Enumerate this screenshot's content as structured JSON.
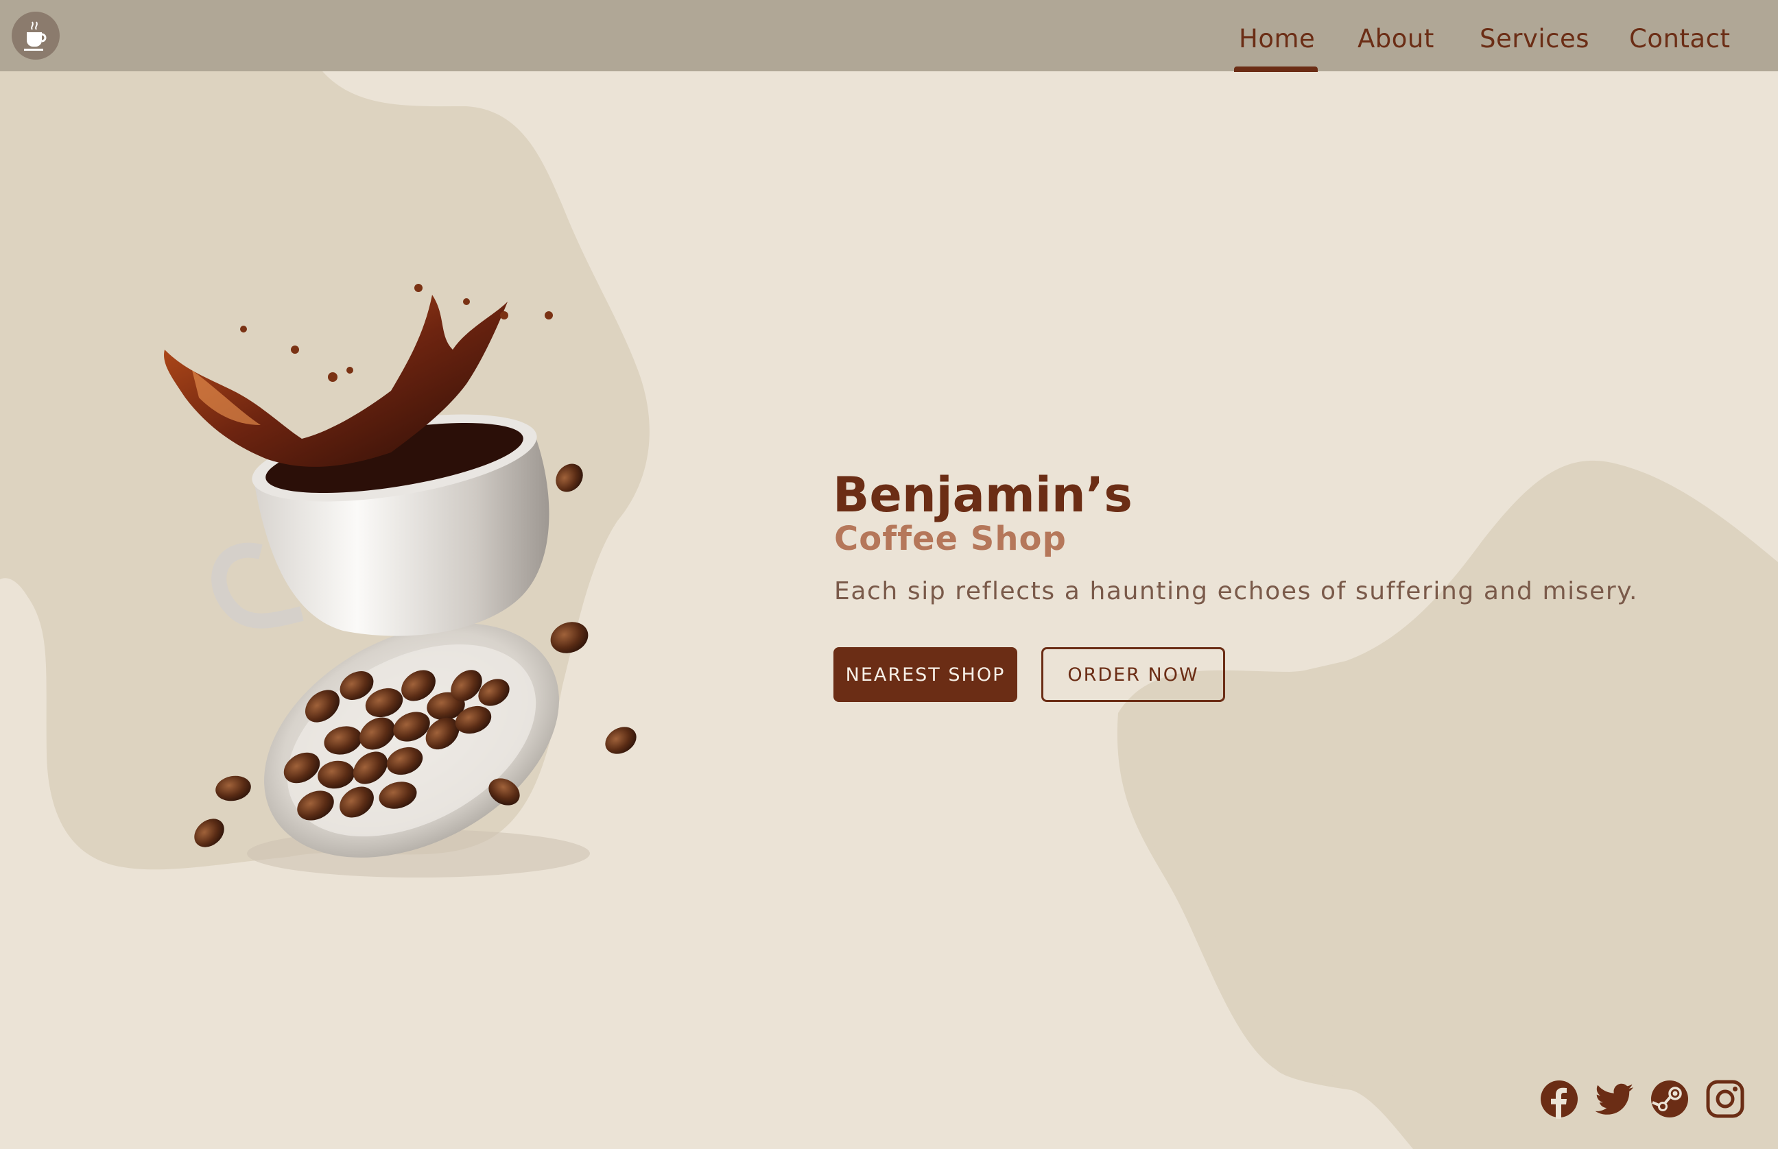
{
  "nav": {
    "items": [
      {
        "label": "Home"
      },
      {
        "label": "About"
      },
      {
        "label": "Services"
      },
      {
        "label": "Contact"
      }
    ],
    "active": "Home"
  },
  "hero": {
    "title": "Benjamin’s",
    "subtitle": "Coffee Shop",
    "tagline": "Each sip reflects a haunting echoes of suffering and misery.",
    "primary_button": "NEAREST SHOP",
    "secondary_button": "ORDER NOW"
  },
  "social": [
    "facebook-icon",
    "twitter-icon",
    "steam-icon",
    "instagram-icon"
  ],
  "colors": {
    "background": "#ebe3d6",
    "blob": "#ddd3c0",
    "navbar": "#b0a796",
    "accent": "#6b2d15",
    "subtitle": "#b5775a",
    "text": "#7a5a4a"
  }
}
